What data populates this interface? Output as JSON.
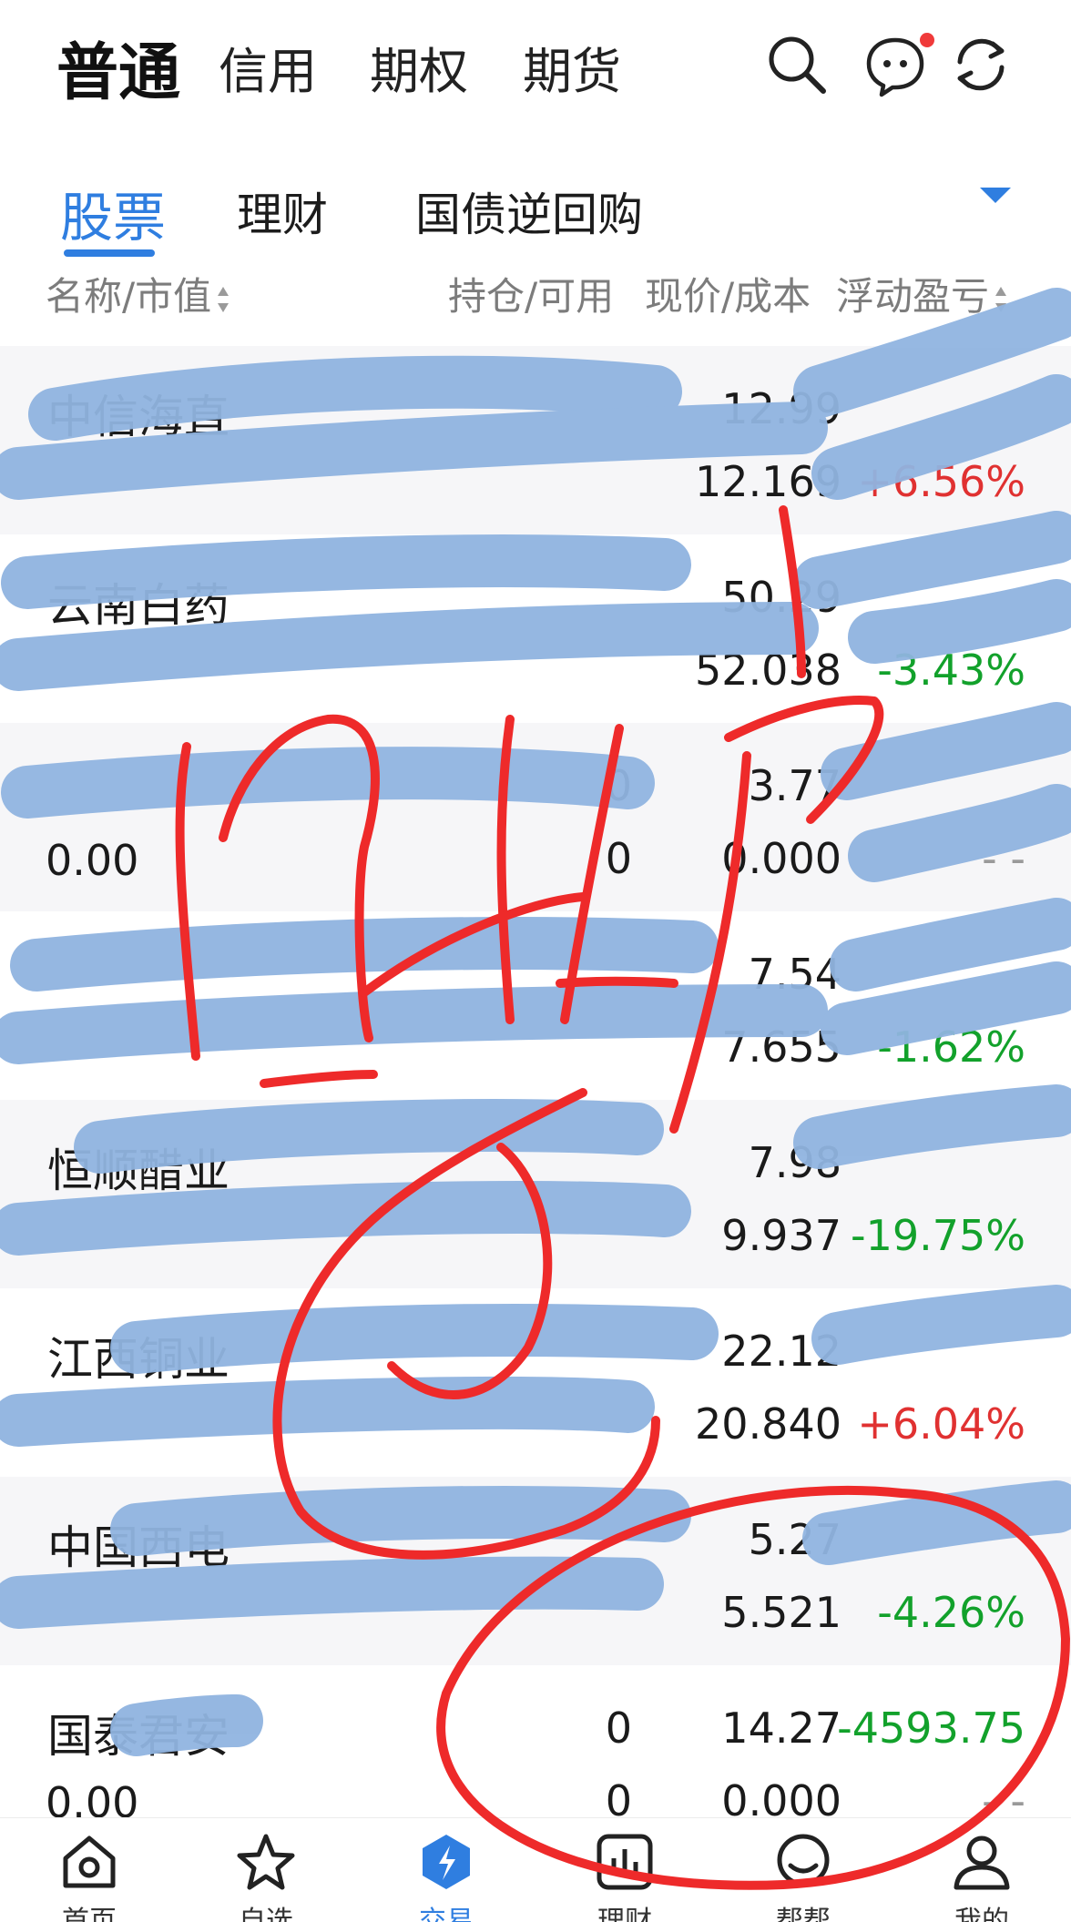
{
  "account_tabs": [
    {
      "label": "普通",
      "active": true
    },
    {
      "label": "信用",
      "active": false
    },
    {
      "label": "期权",
      "active": false
    },
    {
      "label": "期货",
      "active": false
    }
  ],
  "top_icons": [
    "search-icon",
    "message-icon",
    "refresh-icon"
  ],
  "category_tabs": [
    {
      "label": "股票",
      "active": true
    },
    {
      "label": "理财",
      "active": false
    },
    {
      "label": "国债逆回购",
      "active": false
    }
  ],
  "columns": {
    "name_mv": "名称/市值",
    "hold_avail": "持仓/可用",
    "price_cost": "现价/成本",
    "pnl": "浮动盈亏"
  },
  "rows": [
    {
      "name": "中信海直",
      "market_value": "",
      "hold": "",
      "avail": "",
      "price": "12.99",
      "cost": "12.169",
      "pnl": "",
      "pct": "+6.56%",
      "trend": "up"
    },
    {
      "name": "云南白药",
      "market_value": "",
      "hold": "",
      "avail": "",
      "price": "50.29",
      "cost": "52.038",
      "pnl": "",
      "pct": "-3.43%",
      "trend": "down"
    },
    {
      "name": "",
      "market_value": "0.00",
      "hold": "0",
      "avail": "0",
      "price": "3.77",
      "cost": "0.000",
      "pnl": "",
      "pct": "- -",
      "trend": "flat"
    },
    {
      "name": "",
      "market_value": "",
      "hold": "",
      "avail": "",
      "price": "7.54",
      "cost": "7.655",
      "pnl": "",
      "pct": "-1.62%",
      "trend": "down"
    },
    {
      "name": "恒顺醋业",
      "market_value": "",
      "hold": "",
      "avail": "",
      "price": "7.98",
      "cost": "9.937",
      "pnl": "",
      "pct": "-19.75%",
      "trend": "down"
    },
    {
      "name": "江西铜业",
      "market_value": "",
      "hold": "",
      "avail": "",
      "price": "22.12",
      "cost": "20.840",
      "pnl": "",
      "pct": "+6.04%",
      "trend": "up"
    },
    {
      "name": "中国西电",
      "market_value": "",
      "hold": "",
      "avail": "",
      "price": "5.27",
      "cost": "5.521",
      "pnl": "",
      "pct": "-4.26%",
      "trend": "down"
    },
    {
      "name": "国泰君安",
      "market_value": "0.00",
      "hold": "0",
      "avail": "0",
      "price": "14.27",
      "cost": "0.000",
      "pnl": "-4593.75",
      "pct": "- -",
      "trend": "down"
    }
  ],
  "bottom_nav": [
    {
      "label": "首页",
      "icon": "home-icon",
      "active": false
    },
    {
      "label": "自选",
      "icon": "star-icon",
      "active": false
    },
    {
      "label": "交易",
      "icon": "trade-icon",
      "active": true
    },
    {
      "label": "理财",
      "icon": "chart-icon",
      "active": false
    },
    {
      "label": "帮帮",
      "icon": "chat-icon",
      "active": false
    },
    {
      "label": "我的",
      "icon": "user-icon",
      "active": false
    }
  ],
  "colors": {
    "accent": "#2f7ee0",
    "up": "#e03131",
    "down": "#12a12b",
    "scribble_blue": "#90b4e0",
    "scribble_red": "#ee2a2a"
  }
}
